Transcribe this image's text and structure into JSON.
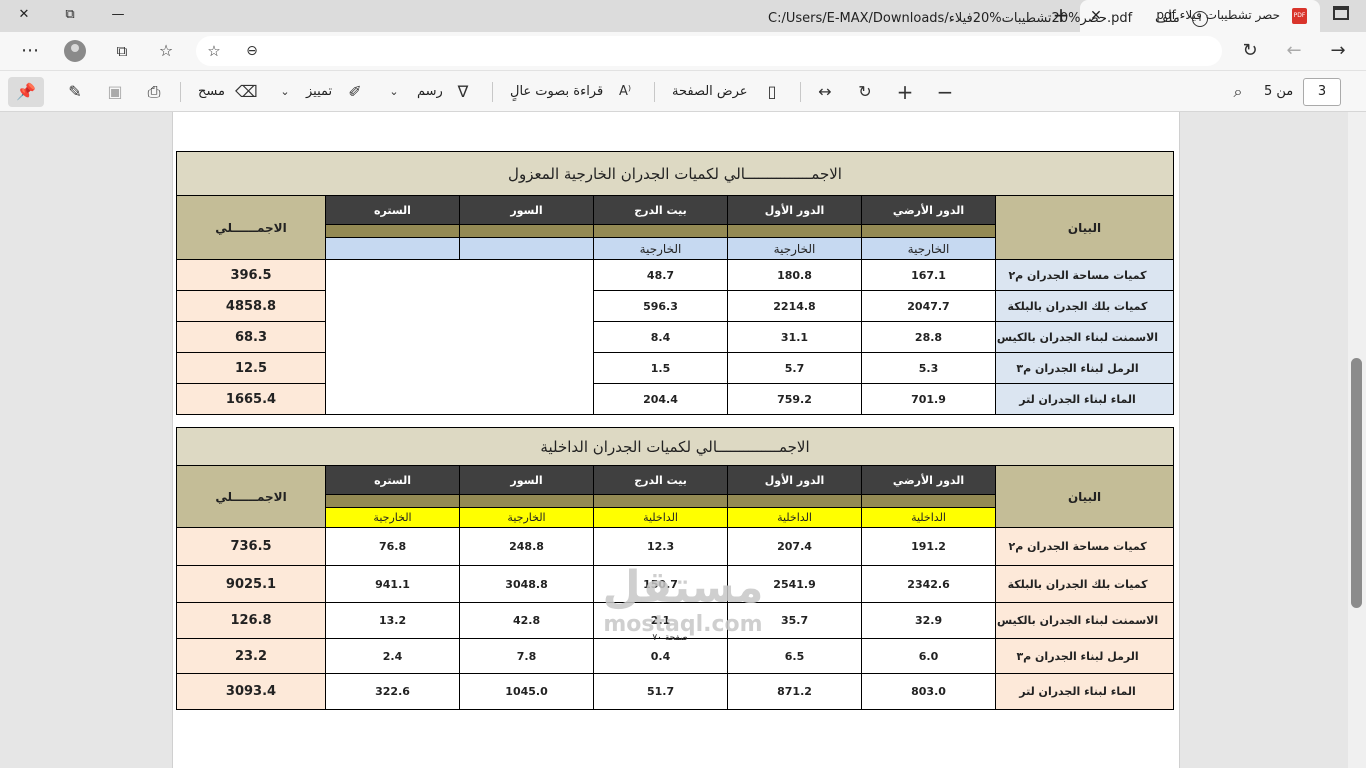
{
  "tab": {
    "title": "حصر تشطيبات فيلاء.pdf",
    "pdf_badge": "PDF"
  },
  "window": {
    "minimize": "—",
    "restore": "⧉",
    "close": "✕"
  },
  "address": {
    "label": "ملف",
    "url": "C:/Users/E-MAX/Downloads/حصر%20تشطيبات%20فيلاء.pdf"
  },
  "toolbar": {
    "erase_label": "مسح",
    "highlight_label": "تمييز",
    "draw_label": "رسم",
    "read_aloud_label": "قراءة بصوت عالٍ",
    "page_view_label": "عرض الصفحة",
    "page_number": "3",
    "page_of": "من 5"
  },
  "table1": {
    "title": "الاجمـــــــــــــــالي لكميات الجدران الخارجية المعزول",
    "bayan": "البيان",
    "total_header": "الاجمــــــلي",
    "columns": [
      "الدور الأرضي",
      "الدور الأول",
      "بيت الدرج",
      "السور",
      "الستره"
    ],
    "subs": [
      "الخارجية",
      "الخارجية",
      "الخارجية",
      "",
      ""
    ],
    "rows": [
      {
        "label": "كميات مساحة الجدران م٢",
        "values": [
          "167.1",
          "180.8",
          "48.7"
        ],
        "total": "396.5"
      },
      {
        "label": "كميات بلك الجدران  بالبلكة",
        "values": [
          "2047.7",
          "2214.8",
          "596.3"
        ],
        "total": "4858.8"
      },
      {
        "label": "الاسمنت لبناء الجدران بالكيس",
        "values": [
          "28.8",
          "31.1",
          "8.4"
        ],
        "total": "68.3"
      },
      {
        "label": "الرمل لبناء الجدران م٣",
        "values": [
          "5.3",
          "5.7",
          "1.5"
        ],
        "total": "12.5"
      },
      {
        "label": "الماء لبناء الجدران لتر",
        "values": [
          "701.9",
          "759.2",
          "204.4"
        ],
        "total": "1665.4"
      }
    ]
  },
  "table2": {
    "title": "الاجمــــــــــــــالي لكميات الجدران الداخلية",
    "bayan": "البيان",
    "total_header": "الاجمــــــلي",
    "columns": [
      "الدور الأرضي",
      "الدور الأول",
      "بيت الدرج",
      "السور",
      "الستره"
    ],
    "subs": [
      "الداخلية",
      "الداخلية",
      "الداخلية",
      "الخارجية",
      "الخارجية"
    ],
    "rows": [
      {
        "label": "كميات مساحة الجدران م٢",
        "values": [
          "191.2",
          "207.4",
          "12.3",
          "248.8",
          "76.8"
        ],
        "total": "736.5"
      },
      {
        "label": "كميات بلك الجدران  بالبلكة",
        "values": [
          "2342.6",
          "2541.9",
          "150.7",
          "3048.8",
          "941.1"
        ],
        "total": "9025.1"
      },
      {
        "label": "الاسمنت لبناء الجدران بالكيس",
        "values": [
          "32.9",
          "35.7",
          "2.1",
          "42.8",
          "13.2"
        ],
        "total": "126.8"
      },
      {
        "label": "الرمل لبناء الجدران م٣",
        "values": [
          "6.0",
          "6.5",
          "0.4",
          "7.8",
          "2.4"
        ],
        "total": "23.2"
      },
      {
        "label": "الماء لبناء الجدران لتر",
        "values": [
          "803.0",
          "871.2",
          "51.7",
          "1045.0",
          "322.6"
        ],
        "total": "3093.4"
      }
    ]
  },
  "watermark": {
    "arabic": "مستقل",
    "latin": "mostaql.com"
  },
  "footer": "صفحة ٧٠"
}
